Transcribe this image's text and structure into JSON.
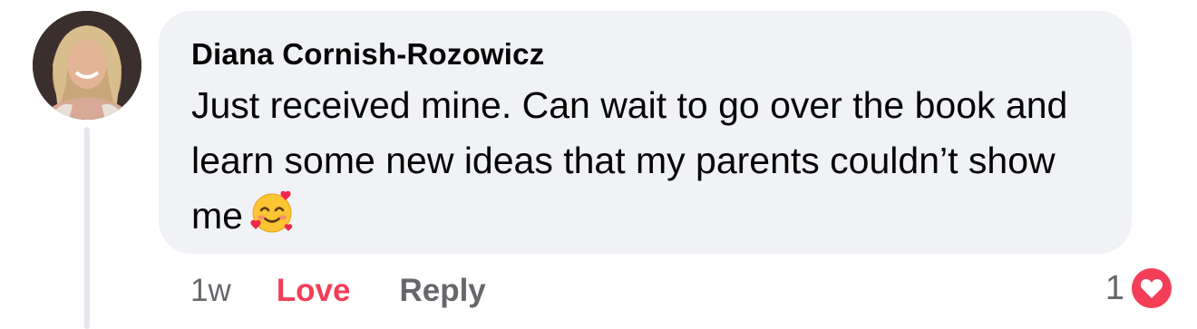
{
  "comment": {
    "author": "Diana Cornish-Rozowicz",
    "text": "Just received mine. Can wait to go over the book and learn some new ideas that my parents couldn’t show me",
    "emoji": "smiling-face-with-hearts-icon",
    "timestamp": "1w",
    "reaction_label": "Love",
    "reply_label": "Reply",
    "reaction_count": "1",
    "reaction_type": "love-reaction-icon"
  },
  "colors": {
    "bubble": "#f0f2f5",
    "love": "#f33e58",
    "muted": "#65676b",
    "text": "#050505",
    "thread_line": "#e4e6eb"
  }
}
